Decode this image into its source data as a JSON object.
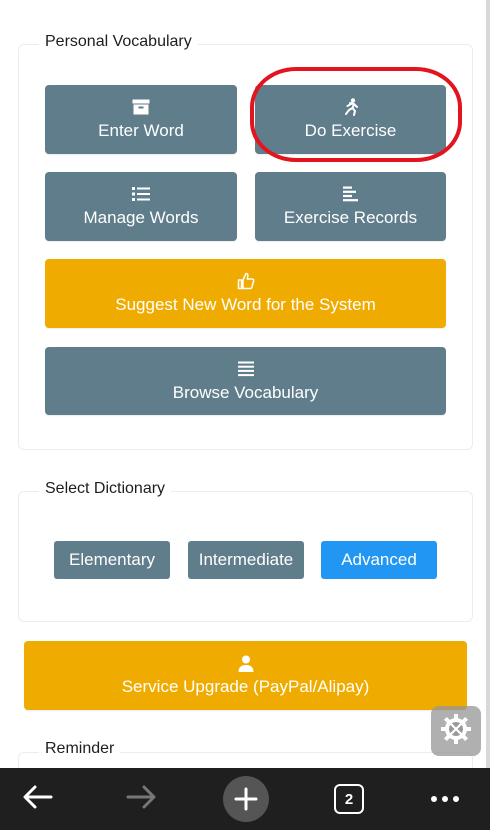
{
  "personal_vocabulary": {
    "title": "Personal Vocabulary",
    "buttons": {
      "enter_word": "Enter Word",
      "do_exercise": "Do Exercise",
      "manage_words": "Manage Words",
      "exercise_records": "Exercise Records",
      "suggest_word": "Suggest New Word for the System",
      "browse_vocabulary": "Browse Vocabulary"
    }
  },
  "select_dictionary": {
    "title": "Select Dictionary",
    "options": [
      "Elementary",
      "Intermediate",
      "Advanced"
    ],
    "selected": "Advanced"
  },
  "service_upgrade": {
    "label": "Service Upgrade (PayPal/Alipay)"
  },
  "reminder": {
    "title": "Reminder"
  },
  "browser_bar": {
    "tab_count": "2",
    "icons": [
      "back-arrow-icon",
      "forward-arrow-icon",
      "plus-icon",
      "tabs-icon",
      "more-icon"
    ]
  },
  "colors": {
    "button_gray": "#607d8b",
    "button_amber": "#f0ab00",
    "selected_blue": "#2196f3",
    "annotation_red": "#e3141e"
  }
}
